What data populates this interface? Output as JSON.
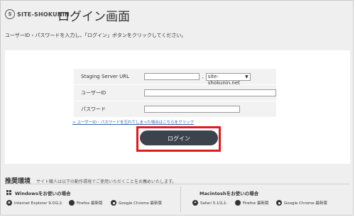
{
  "header": {
    "logo_mark": "S",
    "logo_text": "SITE-SHOKUNIN",
    "title": "ログイン画面"
  },
  "intro": "ユーザーID・パスワードを入力し、「ログイン」ボタンをクリックしてください。",
  "form": {
    "server_label": "Staging Server URL",
    "server_input_value": "",
    "separator": ".",
    "domain_selected": "site-shokunin.net",
    "user_label": "ユーザーID",
    "user_value": "",
    "password_label": "パスワード",
    "password_value": ""
  },
  "forgot_link": "> ユーザーID・パスワードを忘れてしまった場合はこちらをクリック",
  "login_button": "ログイン",
  "highlight_color": "#e01a1a",
  "recommended": {
    "title": "推奨環境",
    "subtitle": "サイト職人は以下の動作環境でご使用いただくことをお薦めいたします。",
    "windows": {
      "heading": "Windowsをお使いの場合",
      "icon": "windows-icon",
      "browsers": [
        {
          "name": "Internet Explorer 9.0以上",
          "icon": "ie-icon"
        },
        {
          "name": "Firefox 最新版",
          "icon": "firefox-icon"
        },
        {
          "name": "Google Chrome 最新版",
          "icon": "chrome-icon"
        }
      ]
    },
    "mac": {
      "heading": "Macintoshをお使いの場合",
      "icon": "apple-icon",
      "browsers": [
        {
          "name": "Safari 5.1以上",
          "icon": "safari-icon"
        },
        {
          "name": "Firefox 最新版",
          "icon": "firefox-icon"
        },
        {
          "name": "Google Chrome 最新版",
          "icon": "chrome-icon"
        }
      ]
    }
  }
}
